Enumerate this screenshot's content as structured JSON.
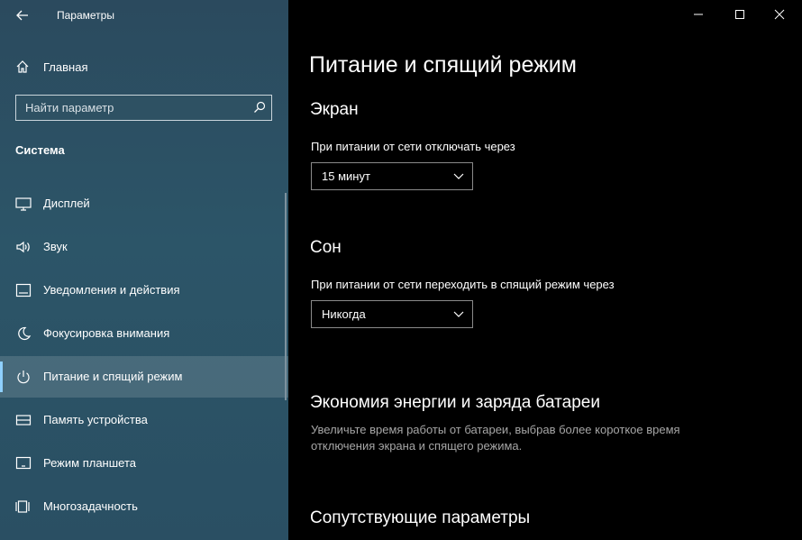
{
  "app": {
    "title": "Параметры"
  },
  "sidebar": {
    "home_label": "Главная",
    "search_placeholder": "Найти параметр",
    "section_title": "Система",
    "items": [
      {
        "label": "Дисплей",
        "icon": "display-icon"
      },
      {
        "label": "Звук",
        "icon": "sound-icon"
      },
      {
        "label": "Уведомления и действия",
        "icon": "notifications-icon"
      },
      {
        "label": "Фокусировка внимания",
        "icon": "focus-moon-icon"
      },
      {
        "label": "Питание и спящий режим",
        "icon": "power-icon",
        "active": true
      },
      {
        "label": "Память устройства",
        "icon": "storage-icon"
      },
      {
        "label": "Режим планшета",
        "icon": "tablet-icon"
      },
      {
        "label": "Многозадачность",
        "icon": "multitasking-icon"
      }
    ]
  },
  "main": {
    "title": "Питание и спящий режим",
    "screen": {
      "heading": "Экран",
      "label": "При питании от сети отключать через",
      "value": "15 минут"
    },
    "sleep": {
      "heading": "Сон",
      "label": "При питании от сети переходить в спящий режим через",
      "value": "Никогда"
    },
    "battery": {
      "heading": "Экономия энергии и заряда батареи",
      "description": "Увеличьте время работы от батареи, выбрав более короткое время отключения экрана и спящего режима."
    },
    "related": {
      "heading": "Сопутствующие параметры"
    }
  },
  "colors": {
    "sidebar_bg": "#2c5165",
    "main_bg": "#000000",
    "accent": "#8fd0ff",
    "secondary_text": "#a6a6a6"
  }
}
